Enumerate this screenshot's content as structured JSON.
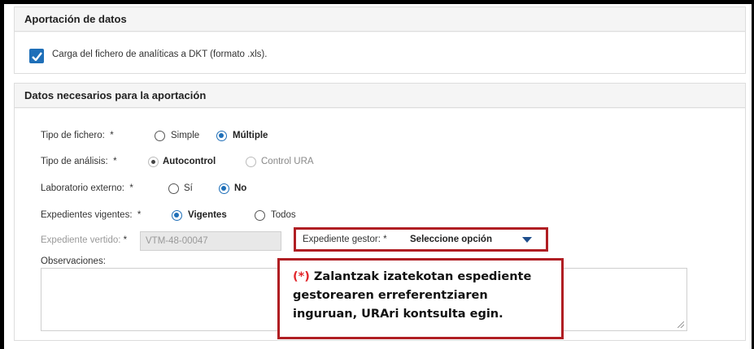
{
  "section1": {
    "title": "Aportación de datos",
    "checkbox_label": "Carga del fichero de analíticas a DKT (formato .xls).",
    "checked": true
  },
  "section2": {
    "title": "Datos necesarios para la aportación",
    "tipo_fichero": {
      "label": "Tipo de fichero:",
      "required": "*",
      "options": [
        "Simple",
        "Múltiple"
      ],
      "selected": "Múltiple"
    },
    "tipo_analisis": {
      "label": "Tipo de análisis:",
      "required": "*",
      "options": [
        "Autocontrol",
        "Control URA"
      ],
      "selected": "Autocontrol"
    },
    "laboratorio_externo": {
      "label": "Laboratorio externo:",
      "required": "*",
      "options": [
        "Sí",
        "No"
      ],
      "selected": "No"
    },
    "expedientes_vigentes": {
      "label": "Expedientes vigentes:",
      "required": "*",
      "options": [
        "Vigentes",
        "Todos"
      ],
      "selected": "Vigentes"
    },
    "expediente_vertido": {
      "label": "Expediente vertido:",
      "required": "*",
      "value": "VTM-48-00047"
    },
    "expediente_gestor": {
      "label": "Expediente gestor:",
      "required": "*",
      "selected": "Seleccione opción"
    },
    "observaciones": {
      "label": "Observaciones:",
      "value": ""
    }
  },
  "note": {
    "star": "(*)",
    "line1": " Zalantzak izatekotan espediente",
    "line2": "gestorearen erreferentziaren",
    "line3": "inguruan, URAri kontsulta egin."
  },
  "colors": {
    "accent": "#1f6fb8",
    "highlight_border": "#b01e23",
    "star_red": "#e2262b"
  }
}
